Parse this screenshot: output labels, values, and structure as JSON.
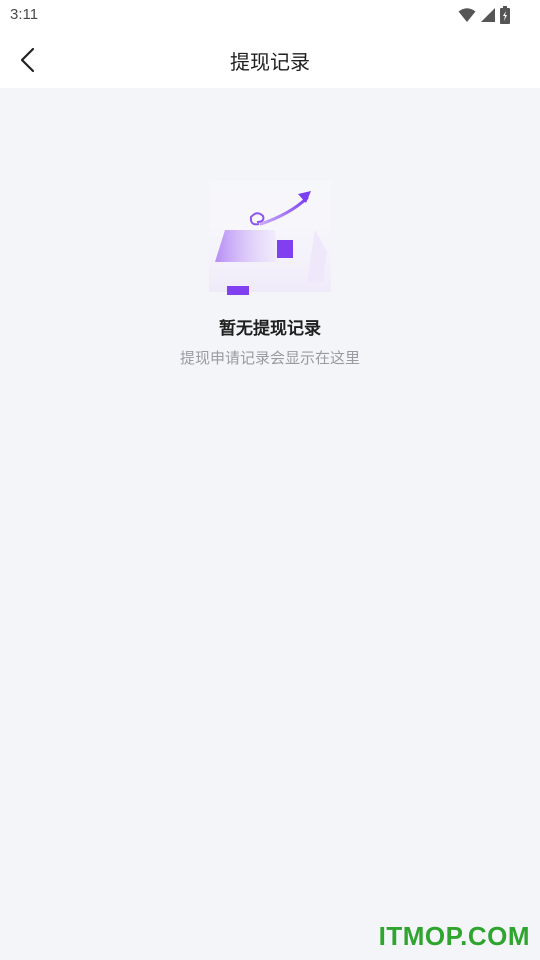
{
  "status_bar": {
    "time": "3:11",
    "icons": [
      "wifi-icon",
      "signal-icon",
      "battery-icon"
    ]
  },
  "header": {
    "back_icon": "chevron-left-icon",
    "title": "提现记录"
  },
  "empty_state": {
    "illustration": "empty-box-illustration",
    "title": "暂无提现记录",
    "subtitle": "提现申请记录会显示在这里"
  },
  "watermark": {
    "text": "ITMOP.COM"
  },
  "colors": {
    "background": "#f4f5f9",
    "accent": "#7b3ff2",
    "watermark": "#2fa52f"
  }
}
